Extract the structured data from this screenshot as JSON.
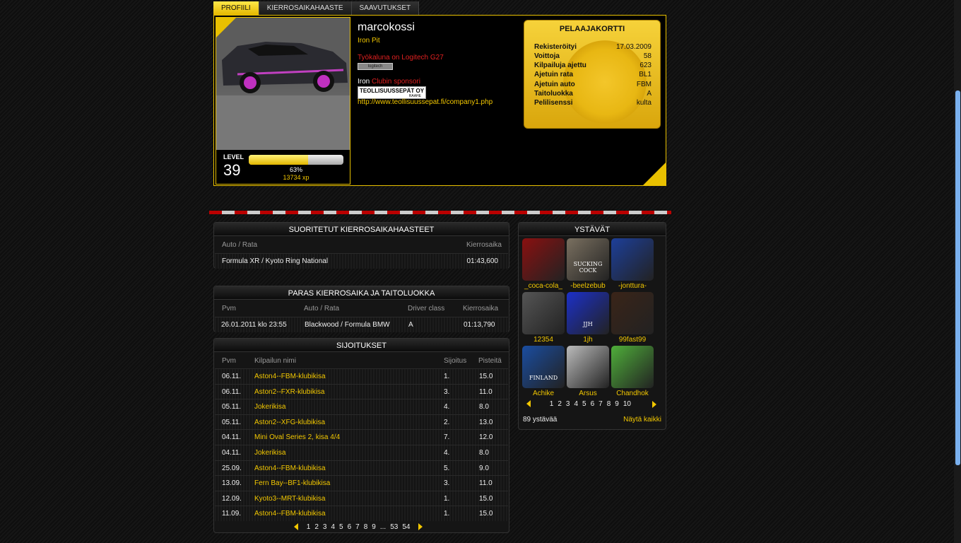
{
  "tabs": [
    "PROFIILI",
    "KIERROSAIKAHAASTE",
    "SAAVUTUKSET"
  ],
  "profile": {
    "username": "marcokossi",
    "team": "Iron Pit",
    "tool_text": "Työkaluna on Logitech G27",
    "badge_label": "logitech",
    "club_prefix": "Iron",
    "club_suffix": "Clubin sponsori",
    "sponsor_logo_text": "TEOLLISUUSSEPÄT OY",
    "sponsor_logo_sub": "RAAHE",
    "sponsor_url": "http://www.teollisuussepat.fi/company1.php",
    "level_label": "LEVEL",
    "level": "39",
    "xp_percent": 63,
    "xp_percent_text": "63%",
    "xp_text": "13734 xp"
  },
  "player_card": {
    "title": "PELAAJAKORTTI",
    "rows": [
      {
        "k": "Rekisteröityi",
        "v": "17.03.2009"
      },
      {
        "k": "Voittoja",
        "v": "58"
      },
      {
        "k": "Kilpailuja ajettu",
        "v": "623"
      },
      {
        "k": "Ajetuin rata",
        "v": "BL1"
      },
      {
        "k": "Ajetuin auto",
        "v": "FBM"
      },
      {
        "k": "Taitoluokka",
        "v": "A"
      },
      {
        "k": "Pelilisenssi",
        "v": "kulta"
      }
    ]
  },
  "completed": {
    "title": "SUORITETUT KIERROSAIKAHAASTEET",
    "col_track": "Auto / Rata",
    "col_time": "Kierrosaika",
    "rows": [
      {
        "track": "Formula XR / Kyoto Ring National",
        "time": "01:43,600"
      }
    ]
  },
  "best": {
    "title": "PARAS KIERROSAIKA JA TAITOLUOKKA",
    "cols": [
      "Pvm",
      "Auto / Rata",
      "Driver class",
      "Kierrosaika"
    ],
    "row": {
      "date": "26.01.2011 klo 23:55",
      "track": "Blackwood / Formula BMW",
      "cls": "A",
      "time": "01:13,790"
    }
  },
  "results": {
    "title": "SIJOITUKSET",
    "cols": [
      "Pvm",
      "Kilpailun nimi",
      "Sijoitus",
      "Pisteitä"
    ],
    "rows": [
      {
        "date": "06.11.",
        "name": "Aston4--FBM-klubikisa",
        "pos": "1.",
        "pts": "15.0"
      },
      {
        "date": "06.11.",
        "name": "Aston2--FXR-klubikisa",
        "pos": "3.",
        "pts": "11.0"
      },
      {
        "date": "05.11.",
        "name": "Jokerikisa",
        "pos": "4.",
        "pts": "8.0"
      },
      {
        "date": "05.11.",
        "name": "Aston2--XFG-klubikisa",
        "pos": "2.",
        "pts": "13.0"
      },
      {
        "date": "04.11.",
        "name": "Mini Oval Series 2, kisa 4/4",
        "pos": "7.",
        "pts": "12.0"
      },
      {
        "date": "04.11.",
        "name": "Jokerikisa",
        "pos": "4.",
        "pts": "8.0"
      },
      {
        "date": "25.09.",
        "name": "Aston4--FBM-klubikisa",
        "pos": "5.",
        "pts": "9.0"
      },
      {
        "date": "13.09.",
        "name": "Fern Bay--BF1-klubikisa",
        "pos": "3.",
        "pts": "11.0"
      },
      {
        "date": "12.09.",
        "name": "Kyoto3--MRT-klubikisa",
        "pos": "1.",
        "pts": "15.0"
      },
      {
        "date": "11.09.",
        "name": "Aston4--FBM-klubikisa",
        "pos": "1.",
        "pts": "15.0"
      }
    ],
    "pages": [
      "1",
      "2",
      "3",
      "4",
      "5",
      "6",
      "7",
      "8",
      "9",
      "...",
      "53",
      "54"
    ]
  },
  "friends": {
    "title": "YSTÄVÄT",
    "list": [
      {
        "name": "_coca-cola_",
        "color": "#8a1010"
      },
      {
        "name": "-beelzebub",
        "color": "#7a7060",
        "caption": "SUCKING COCK"
      },
      {
        "name": "-jonttura-",
        "color": "#1d3f9a"
      },
      {
        "name": "12354",
        "color": "#555"
      },
      {
        "name": "1jh",
        "color": "#1c30c8",
        "caption": "JJH"
      },
      {
        "name": "99fast99",
        "color": "#3a2418"
      },
      {
        "name": "Achike",
        "color": "#1a4da0",
        "caption": "FINLAND"
      },
      {
        "name": "Arsus",
        "color": "#bbbbbb"
      },
      {
        "name": "Chandhok",
        "color": "#4fae3a"
      }
    ],
    "pages": [
      "1",
      "2",
      "3",
      "4",
      "5",
      "6",
      "7",
      "8",
      "9",
      "10"
    ],
    "count_text": "89 ystävää",
    "show_all": "Näytä kaikki"
  }
}
